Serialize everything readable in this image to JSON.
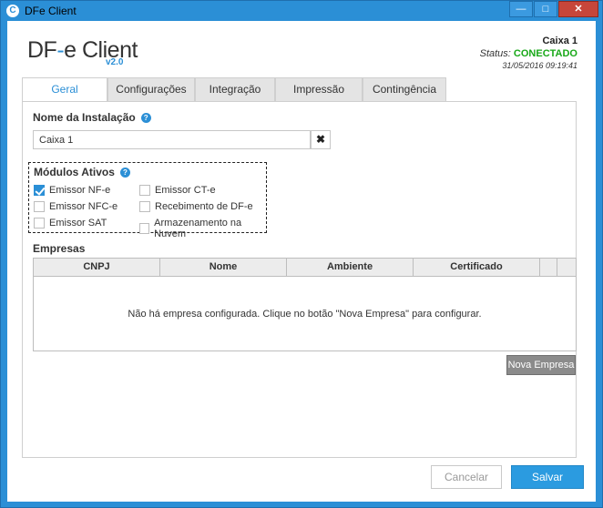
{
  "window": {
    "title": "DFe Client",
    "app_icon": "C",
    "minimize": "—",
    "maximize": "□",
    "close": "✕"
  },
  "header": {
    "logo_left": "DF",
    "logo_sep": "-",
    "logo_right": "e Client",
    "version": "v2.0",
    "name": "Caixa 1",
    "status_label": "Status:",
    "status_value": "CONECTADO",
    "timestamp": "31/05/2016 09:19:41"
  },
  "tabs": [
    {
      "label": "Geral"
    },
    {
      "label": "Configurações"
    },
    {
      "label": "Integração"
    },
    {
      "label": "Impressão"
    },
    {
      "label": "Contingência"
    }
  ],
  "install": {
    "title": "Nome da Instalação",
    "value": "Caixa 1",
    "clear": "✖"
  },
  "modules": {
    "title": "Módulos Ativos",
    "items": [
      {
        "label": "Emissor NF-e",
        "checked": true
      },
      {
        "label": "Emissor NFC-e",
        "checked": false
      },
      {
        "label": "Emissor SAT",
        "checked": false
      },
      {
        "label": "Emissor CT-e",
        "checked": false
      },
      {
        "label": "Recebimento de DF-e",
        "checked": false
      },
      {
        "label": "Armazenamento na Nuvem",
        "checked": false
      }
    ]
  },
  "companies": {
    "title": "Empresas",
    "columns": [
      "CNPJ",
      "Nome",
      "Ambiente",
      "Certificado"
    ],
    "empty_message": "Não há empresa configurada. Clique no botão \"Nova Empresa\" para configurar.",
    "new_button": "Nova Empresa"
  },
  "footer": {
    "cancel": "Cancelar",
    "save": "Salvar"
  },
  "help_icon_glyph": "?"
}
